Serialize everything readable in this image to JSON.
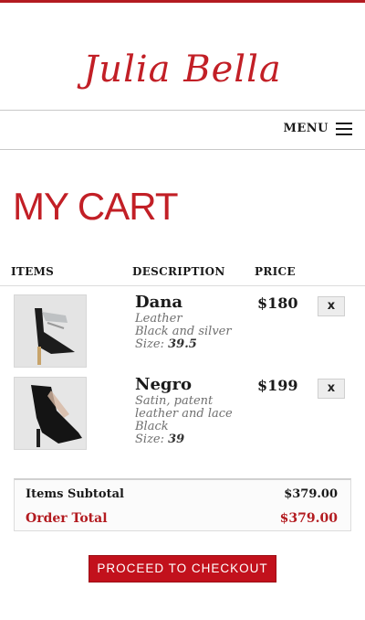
{
  "brand": {
    "logo_text": "Julia Bella",
    "accent_color": "#c21f26"
  },
  "nav": {
    "menu_label": "MENU",
    "menu_icon": "hamburger-icon"
  },
  "page": {
    "title": "MY CART"
  },
  "table": {
    "headers": {
      "items": "ITEMS",
      "description": "DESCRIPTION",
      "price": "PRICE"
    },
    "rows": [
      {
        "name": "Dana",
        "desc_lines": [
          "Leather",
          "Black and silver"
        ],
        "size_label": "Size:",
        "size": "39.5",
        "price": "$180",
        "remove_label": "x"
      },
      {
        "name": "Negro",
        "desc_lines": [
          "Satin, patent",
          "leather and lace",
          "Black"
        ],
        "size_label": "Size:",
        "size": "39",
        "price": "$199",
        "remove_label": "x"
      }
    ]
  },
  "totals": {
    "subtotal_label": "Items Subtotal",
    "subtotal_value": "$379.00",
    "order_total_label": "Order Total",
    "order_total_value": "$379.00"
  },
  "checkout": {
    "label": "PROCEED TO CHECKOUT"
  }
}
